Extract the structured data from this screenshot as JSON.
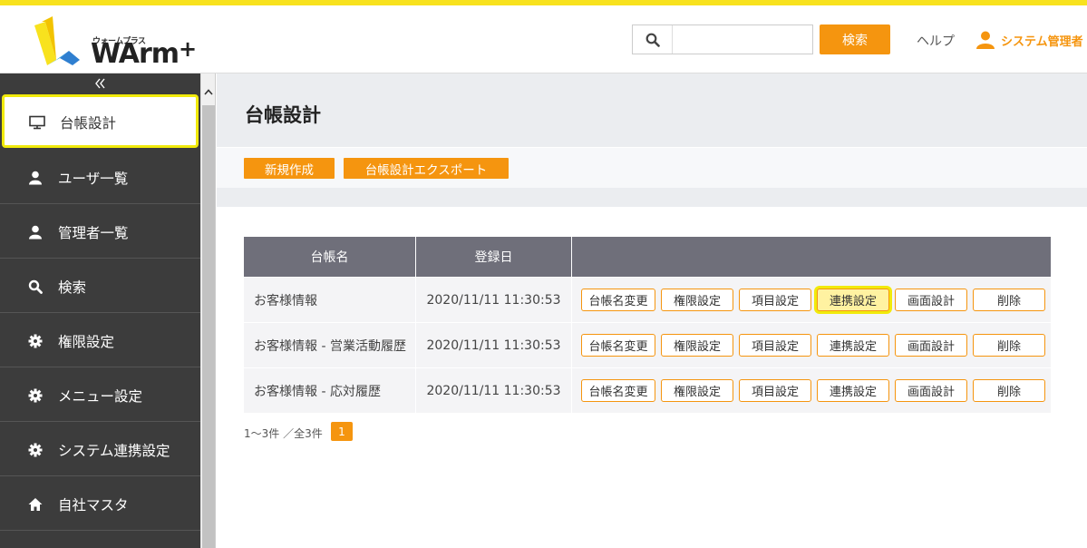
{
  "brand": {
    "logo_kana": "ウォームプラス",
    "logo_text": "WArm",
    "logo_plus": "+",
    "accent": "#f5950f",
    "stripe": "#f8e21e"
  },
  "header": {
    "search_placeholder": "",
    "search_button": "検索",
    "help": "ヘルプ",
    "admin": "システム管理者",
    "icons": {
      "search": "search-icon",
      "user": "user-icon"
    }
  },
  "sidebar": {
    "collapse_label": "«",
    "items": [
      {
        "label": "台帳設計",
        "icon": "monitor-icon",
        "active": true
      },
      {
        "label": "ユーザ一覧",
        "icon": "user-icon"
      },
      {
        "label": "管理者一覧",
        "icon": "user-icon"
      },
      {
        "label": "検索",
        "icon": "search-icon"
      },
      {
        "label": "権限設定",
        "icon": "gear-icon"
      },
      {
        "label": "メニュー設定",
        "icon": "gear-icon"
      },
      {
        "label": "システム連携設定",
        "icon": "gear-icon"
      },
      {
        "label": "自社マスタ",
        "icon": "home-icon"
      }
    ]
  },
  "main": {
    "title": "台帳設計",
    "actions": {
      "new": "新規作成",
      "export": "台帳設計エクスポート"
    },
    "table": {
      "headers": [
        "台帳名",
        "登録日",
        ""
      ],
      "op_labels": [
        "台帳名変更",
        "権限設定",
        "項目設定",
        "連携設定",
        "画面設計",
        "削除"
      ],
      "rows": [
        {
          "name": "お客様情報",
          "date": "2020/11/11 11:30:53"
        },
        {
          "name": "お客様情報 - 営業活動履歴",
          "date": "2020/11/11 11:30:53"
        },
        {
          "name": "お客様情報 - 応対履歴",
          "date": "2020/11/11 11:30:53"
        }
      ]
    },
    "pager": {
      "summary": "1〜3件 ／全3件",
      "current": "1"
    }
  }
}
